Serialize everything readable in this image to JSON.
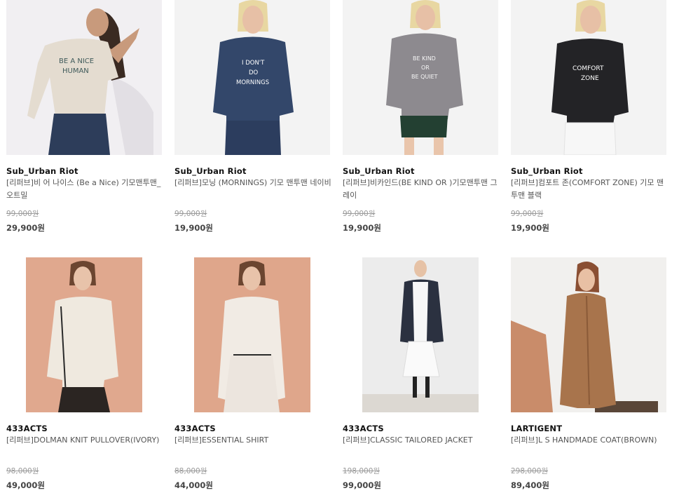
{
  "products": [
    {
      "brand": "Sub_Urban Riot",
      "name": "[리퍼브]비 어 나이스 (Be a Nice) 기모맨투맨_오트밀",
      "original_price": "99,000원",
      "sale_price": "29,900원",
      "shirt_text": [
        "BE A NICE",
        "HUMAN"
      ]
    },
    {
      "brand": "Sub_Urban Riot",
      "name": "[리퍼브]모닝 (MORNINGS) 기모 맨투맨 네이비",
      "original_price": "99,000원",
      "sale_price": "19,900원",
      "shirt_text": [
        "I DON'T",
        "DO",
        "MORNINGS"
      ]
    },
    {
      "brand": "Sub_Urban Riot",
      "name": "[리퍼브]비카인드(BE KIND OR )기모맨투맨 그레이",
      "original_price": "99,000원",
      "sale_price": "19,900원",
      "shirt_text": [
        "BE KIND",
        "OR",
        "BE QUIET"
      ]
    },
    {
      "brand": "Sub_Urban Riot",
      "name": "[리퍼브]컴포트 존(COMFORT ZONE) 기모 맨투맨 블랙",
      "original_price": "99,000원",
      "sale_price": "19,900원",
      "shirt_text": [
        "COMFORT",
        "ZONE"
      ]
    },
    {
      "brand": "433ACTS",
      "name": "[리퍼브]DOLMAN KNIT PULLOVER(IVORY)",
      "original_price": "98,000원",
      "sale_price": "49,000원"
    },
    {
      "brand": "433ACTS",
      "name": "[리퍼브]ESSENTIAL SHIRT",
      "original_price": "88,000원",
      "sale_price": "44,000원"
    },
    {
      "brand": "433ACTS",
      "name": "[리퍼브]CLASSIC TAILORED JACKET",
      "original_price": "198,000원",
      "sale_price": "99,000원"
    },
    {
      "brand": "LARTIGENT",
      "name": "[리퍼브]L S HANDMADE COAT(BROWN)",
      "original_price": "298,000원",
      "sale_price": "89,400원"
    }
  ],
  "colors": {
    "oatmeal": "#e4dcd0",
    "navy": "#33476a",
    "grey": "#8d8a8f",
    "black": "#232326",
    "peach": "#e0a88e",
    "coat_brown": "#a8744c",
    "jacket_navy": "#2b3140"
  }
}
